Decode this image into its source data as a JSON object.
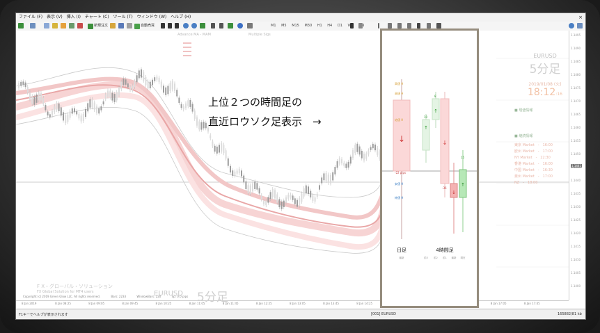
{
  "menu": {
    "items": [
      "ファイル (F)",
      "表示 (V)",
      "挿入 (I)",
      "チャート (C)",
      "ツール (T)",
      "ウィンドウ (W)",
      "ヘルプ (H)"
    ],
    "close_glyph": "×"
  },
  "toolbar": {
    "new_order": "新規注文",
    "auto_trading": "自動売買",
    "timeframes": [
      "M1",
      "M5",
      "M15",
      "M30",
      "H1",
      "H4",
      "D1",
      "W1",
      "MN"
    ]
  },
  "callout": {
    "line1": "上位２つの時間足の",
    "line2": "直近ロウソク足表示　→"
  },
  "panel": {
    "daily_label": "日足",
    "h4_label": "4時間足",
    "daily_sub": "最新",
    "h4_subs": [
      "前3",
      "前2",
      "前1",
      "最新",
      "現在"
    ],
    "pips_label": "-22 pips",
    "pips_h4": "-36",
    "level_labels": [
      "高値 H",
      "安値 H",
      "始値 H",
      "終値 H",
      "高値 H"
    ],
    "h4_value_labels": [
      "10",
      "8",
      "15"
    ]
  },
  "side_panel": {
    "pair": "EURUSD",
    "timeframe": "5分足",
    "date": "2019/01/08 (火)",
    "time": "18:12",
    "seconds": ":16",
    "section1": "■ 現値情報",
    "section2": "■ 継続情報",
    "right_section": "（平均値）",
    "rows": [
      "東京 Market　-　16:00",
      "欧州 Market　-　17:00",
      "NY Market　-　22:30",
      "香港 Market　-　16:00",
      "中国 Market　-　16:30",
      "豪州 Market　-　17:00",
      "NZ　-　18:00"
    ]
  },
  "chart_overlay": {
    "indicator1": "Advance MA - MAM",
    "indicator2": "Multiple Sigs",
    "brand_jp": "F X・グローバル・ソリューション",
    "brand_en": "FX Global Solution for MT4 users",
    "pair": "EURUSD",
    "tf": "5分足",
    "copyright": "Copyright (c) 2019 Green Glow LLC. All rights reserved.",
    "bars": "Bars: 2233",
    "window_bars": "WindowBars: 220",
    "sp": "Sp: 0.0 pips"
  },
  "price_scale": [
    "1.1495",
    "1.1490",
    "1.1485",
    "1.1480",
    "1.1475",
    "1.1470",
    "1.1465",
    "1.1460",
    "1.1455",
    "1.1450",
    "1.1445",
    "1.1440",
    "1.1435",
    "1.1430",
    "1.1425",
    "1.1420",
    "1.1415",
    "1.1410",
    "1.1405",
    "1.1400"
  ],
  "price_current": "1.1441",
  "time_axis": [
    "8 Jan 2019",
    "8 Jan 08:25",
    "8 Jan 09:05",
    "8 Jan 09:45",
    "8 Jan 10:25",
    "8 Jan 11:05",
    "8 Jan 11:45",
    "8 Jan 12:25",
    "8 Jan 13:05",
    "8 Jan 13:45",
    "8 Jan 14:25",
    "8 Jan 15:05",
    "8 Jan 15:45",
    "8 Jan 16:25",
    "8 Jan 17:05",
    "8 Jan 17:45"
  ],
  "status": {
    "help": "F1キーでヘルプが表示されます",
    "profile": "Default",
    "symbol": "[001] EURUSD",
    "traffic": "165882/81 kb"
  }
}
